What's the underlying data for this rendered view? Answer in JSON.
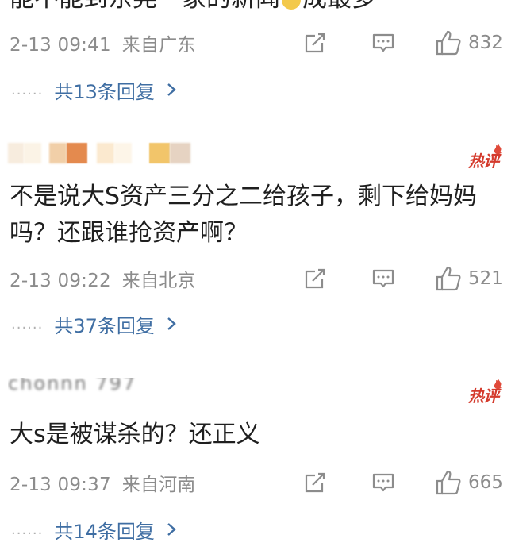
{
  "top_comment": {
    "text_cut": "能不能到东莞一家的新闻",
    "text_cut_tail": "成最多"
  },
  "comments": [
    {
      "time": "2-13 09:41",
      "location": "来自广东",
      "likes": "832",
      "replies": "共13条回复"
    },
    {
      "username": "",
      "badge": "热评",
      "text": "不是说大S资产三分之二给孩子，剩下给妈妈吗？还跟谁抢资产啊？",
      "time": "2-13 09:22",
      "location": "来自北京",
      "likes": "521",
      "replies": "共37条回复"
    },
    {
      "username": "chonnn 797",
      "badge": "热评",
      "text": "大s是被谋杀的？还正义",
      "time": "2-13 09:37",
      "location": "来自河南",
      "likes": "665",
      "replies": "共14条回复"
    }
  ],
  "ui": {
    "reply_dots": "......",
    "accent_color": "#3f6ea3",
    "hot_color": "#d43a2c",
    "meta_color": "#8c8c8c"
  }
}
